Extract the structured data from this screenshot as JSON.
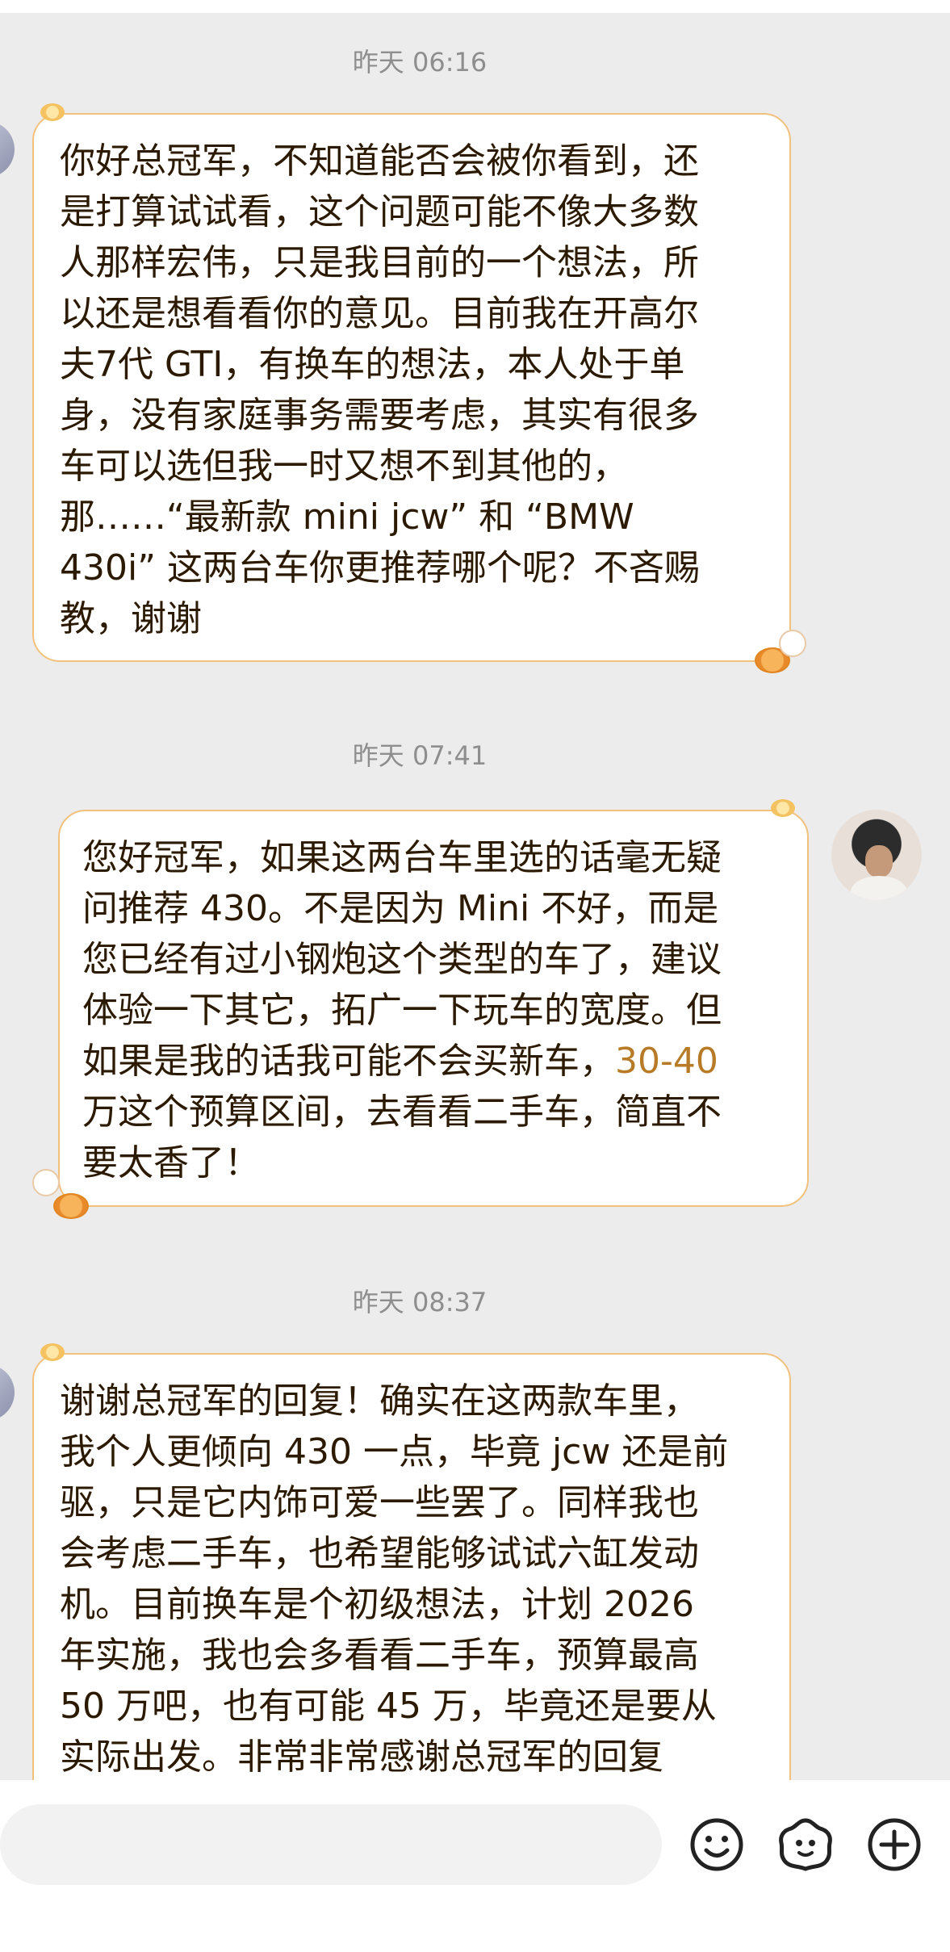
{
  "conversation": {
    "messages": [
      {
        "timestamp": "昨天 06:16",
        "sender": "user",
        "text": "你好总冠军，不知道能否会被你看到，还\n是打算试试看，这个问题可能不像大多数\n人那样宏伟，只是我目前的一个想法，所\n以还是想看看你的意见。目前我在开高尔\n夫7代 GTI，有换车的想法，本人处于单\n身，没有家庭事务需要考虑，其实有很多\n车可以选但我一时又想不到其他的，\n那……“最新款 mini jcw” 和 “BMW\n430i” 这两台车你更推荐哪个呢？不吝赐\n教，谢谢"
      },
      {
        "timestamp": "昨天 07:41",
        "sender": "champion",
        "text_before": "您好冠军，如果这两台车里选的话毫无疑\n问推荐 430。不是因为 Mini 不好，而是\n您已经有过小钢炮这个类型的车了，建议\n体验一下其它，拓广一下玩车的宽度。但\n如果是我的话我可能不会买新车，",
        "highlight": "30-40",
        "text_after": "\n万这个预算区间，去看看二手车，简直不\n要太香了！"
      },
      {
        "timestamp": "昨天 08:37",
        "sender": "user",
        "text": "谢谢总冠军的回复！确实在这两款车里，\n我个人更倾向 430 一点，毕竟 jcw 还是前\n驱，只是它内饰可爱一些罢了。同样我也\n会考虑二手车，也希望能够试试六缸发动\n机。目前换车是个初级想法，计划 2026\n年实施，我也会多看看二手车，预算最高\n50 万吧，也有可能 45 万，毕竟还是要从\n实际出发。非常非常感谢总冠军的回复"
      }
    ]
  },
  "composer": {
    "input_placeholder": "",
    "icons": [
      "emoji-icon",
      "sticker-icon",
      "plus-icon"
    ]
  },
  "colors": {
    "background": "#ececec",
    "bubble_border": "#f2c17d",
    "text": "#2b1900",
    "timestamp": "#8e8e8e",
    "highlight": "#b77b28"
  }
}
